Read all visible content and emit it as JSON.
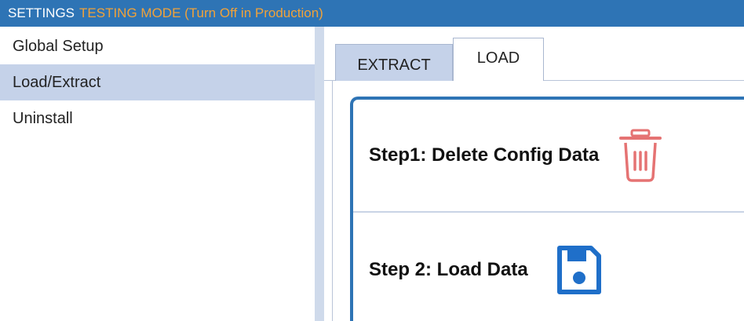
{
  "titlebar": {
    "title": "SETTINGS",
    "mode": "TESTING MODE (Turn Off in Production)"
  },
  "sidebar": {
    "items": [
      {
        "label": "Global Setup",
        "active": false
      },
      {
        "label": "Load/Extract",
        "active": true
      },
      {
        "label": "Uninstall",
        "active": false
      }
    ]
  },
  "tabs": [
    {
      "label": "EXTRACT",
      "selected": false
    },
    {
      "label": "LOAD",
      "selected": true
    }
  ],
  "steps": [
    {
      "label": "Step1: Delete Config Data",
      "icon": "trash-icon"
    },
    {
      "label": "Step 2: Load Data",
      "icon": "save-icon"
    }
  ],
  "colors": {
    "titlebar": "#2e74b5",
    "mode_text": "#f0a23a",
    "sidebar_active": "#c5d2e9",
    "panel_border": "#2e74b5",
    "trash_icon": "#e57373",
    "save_icon": "#1f6fc9"
  }
}
